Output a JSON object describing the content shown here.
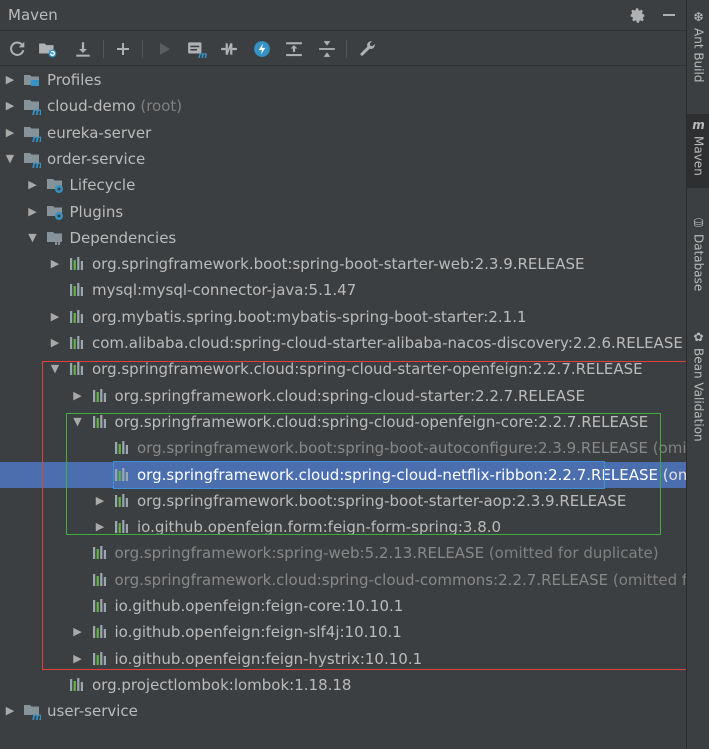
{
  "panel": {
    "title": "Maven"
  },
  "titlebar_icons": [
    {
      "name": "gear-icon"
    },
    {
      "name": "hide-icon"
    }
  ],
  "toolbar": {
    "buttons": [
      {
        "name": "reload-all-projects-button",
        "icon": "refresh-icon",
        "enabled": true
      },
      {
        "name": "generate-sources-button",
        "icon": "folder-sync-icon",
        "enabled": true
      },
      {
        "name": "download-sources-button",
        "icon": "download-icon",
        "enabled": true
      },
      {
        "name": "add-maven-project-button",
        "icon": "plus-icon",
        "enabled": true
      },
      {
        "name": "run-maven-build-button",
        "icon": "play-icon",
        "enabled": false
      },
      {
        "name": "execute-maven-goal-button",
        "icon": "maven-goal-icon",
        "enabled": true
      },
      {
        "name": "toggle-offline-mode-button",
        "icon": "offline-icon",
        "enabled": true
      },
      {
        "name": "skip-tests-button",
        "icon": "lightning-icon",
        "enabled": true
      },
      {
        "name": "show-dependencies-button",
        "icon": "dependencies-icon",
        "enabled": true
      },
      {
        "name": "collapse-all-button",
        "icon": "collapse-icon",
        "enabled": true
      },
      {
        "name": "maven-settings-button",
        "icon": "wrench-icon",
        "enabled": true
      }
    ]
  },
  "tree": [
    {
      "label": "Profiles",
      "suffix": "",
      "depth": 0,
      "arrow": "right",
      "icon": "profiles-folder-icon",
      "selected": false,
      "dim": false
    },
    {
      "label": "cloud-demo",
      "suffix": " (root)",
      "depth": 0,
      "arrow": "right",
      "icon": "maven-module-icon",
      "selected": false,
      "dim": false
    },
    {
      "label": "eureka-server",
      "suffix": "",
      "depth": 0,
      "arrow": "right",
      "icon": "maven-module-icon",
      "selected": false,
      "dim": false
    },
    {
      "label": "order-service",
      "suffix": "",
      "depth": 0,
      "arrow": "down",
      "icon": "maven-module-icon",
      "selected": false,
      "dim": false
    },
    {
      "label": "Lifecycle",
      "suffix": "",
      "depth": 1,
      "arrow": "right",
      "icon": "lifecycle-folder-icon",
      "selected": false,
      "dim": false
    },
    {
      "label": "Plugins",
      "suffix": "",
      "depth": 1,
      "arrow": "right",
      "icon": "plugins-folder-icon",
      "selected": false,
      "dim": false
    },
    {
      "label": "Dependencies",
      "suffix": "",
      "depth": 1,
      "arrow": "down",
      "icon": "dependencies-folder-icon",
      "selected": false,
      "dim": false
    },
    {
      "label": "org.springframework.boot:spring-boot-starter-web:2.3.9.RELEASE",
      "suffix": "",
      "depth": 2,
      "arrow": "right",
      "icon": "library-icon",
      "selected": false,
      "dim": false
    },
    {
      "label": "mysql:mysql-connector-java:5.1.47",
      "suffix": "",
      "depth": 2,
      "arrow": "none",
      "icon": "library-icon",
      "selected": false,
      "dim": false
    },
    {
      "label": "org.mybatis.spring.boot:mybatis-spring-boot-starter:2.1.1",
      "suffix": "",
      "depth": 2,
      "arrow": "right",
      "icon": "library-icon",
      "selected": false,
      "dim": false
    },
    {
      "label": "com.alibaba.cloud:spring-cloud-starter-alibaba-nacos-discovery:2.2.6.RELEASE",
      "suffix": "",
      "depth": 2,
      "arrow": "right",
      "icon": "library-icon",
      "selected": false,
      "dim": false
    },
    {
      "label": "org.springframework.cloud:spring-cloud-starter-openfeign:2.2.7.RELEASE",
      "suffix": "",
      "depth": 2,
      "arrow": "down",
      "icon": "library-icon",
      "selected": false,
      "dim": false
    },
    {
      "label": "org.springframework.cloud:spring-cloud-starter:2.2.7.RELEASE",
      "suffix": "",
      "depth": 3,
      "arrow": "right",
      "icon": "library-icon",
      "selected": false,
      "dim": false
    },
    {
      "label": "org.springframework.cloud:spring-cloud-openfeign-core:2.2.7.RELEASE",
      "suffix": "",
      "depth": 3,
      "arrow": "down",
      "icon": "library-icon",
      "selected": false,
      "dim": false
    },
    {
      "label": "org.springframework.boot:spring-boot-autoconfigure:2.3.9.RELEASE",
      "suffix": " (omitt",
      "depth": 4,
      "arrow": "none",
      "icon": "library-icon",
      "selected": false,
      "dim": true
    },
    {
      "label": "org.springframework.cloud:spring-cloud-netflix-ribbon:2.2.7.RELEASE",
      "suffix": " (omitted",
      "depth": 4,
      "arrow": "none",
      "icon": "library-icon",
      "selected": true,
      "dim": false
    },
    {
      "label": "org.springframework.boot:spring-boot-starter-aop:2.3.9.RELEASE",
      "suffix": "",
      "depth": 4,
      "arrow": "right",
      "icon": "library-icon",
      "selected": false,
      "dim": false
    },
    {
      "label": "io.github.openfeign.form:feign-form-spring:3.8.0",
      "suffix": "",
      "depth": 4,
      "arrow": "right",
      "icon": "library-icon",
      "selected": false,
      "dim": false
    },
    {
      "label": "org.springframework:spring-web:5.2.13.RELEASE",
      "suffix": " (omitted for duplicate)",
      "depth": 3,
      "arrow": "none",
      "icon": "library-icon",
      "selected": false,
      "dim": true
    },
    {
      "label": "org.springframework.cloud:spring-cloud-commons:2.2.7.RELEASE",
      "suffix": " (omitted for",
      "depth": 3,
      "arrow": "none",
      "icon": "library-icon",
      "selected": false,
      "dim": true
    },
    {
      "label": "io.github.openfeign:feign-core:10.10.1",
      "suffix": "",
      "depth": 3,
      "arrow": "none",
      "icon": "library-icon",
      "selected": false,
      "dim": false
    },
    {
      "label": "io.github.openfeign:feign-slf4j:10.10.1",
      "suffix": "",
      "depth": 3,
      "arrow": "right",
      "icon": "library-icon",
      "selected": false,
      "dim": false
    },
    {
      "label": "io.github.openfeign:feign-hystrix:10.10.1",
      "suffix": "",
      "depth": 3,
      "arrow": "right",
      "icon": "library-icon",
      "selected": false,
      "dim": false
    },
    {
      "label": "org.projectlombok:lombok:1.18.18",
      "suffix": "",
      "depth": 2,
      "arrow": "none",
      "icon": "library-icon",
      "selected": false,
      "dim": false
    },
    {
      "label": "user-service",
      "suffix": "",
      "depth": 0,
      "arrow": "right",
      "icon": "maven-module-icon",
      "selected": false,
      "dim": false
    }
  ],
  "side_stripe": [
    {
      "label": "Ant Build",
      "icon": "ant-icon",
      "active": false
    },
    {
      "label": "Maven",
      "icon": "maven-m-icon",
      "active": true
    },
    {
      "label": "Database",
      "icon": "database-icon",
      "active": false
    },
    {
      "label": "Bean Validation",
      "icon": "bean-validation-icon",
      "active": false
    }
  ],
  "colors": {
    "background": "#3c3f41",
    "selection": "#4b6eaf",
    "text": "#bbbbbb",
    "dim_text": "#888888",
    "outline_red": "#e0413b",
    "outline_green": "#3fae3f",
    "outline_blue": "#3d8fd9"
  }
}
